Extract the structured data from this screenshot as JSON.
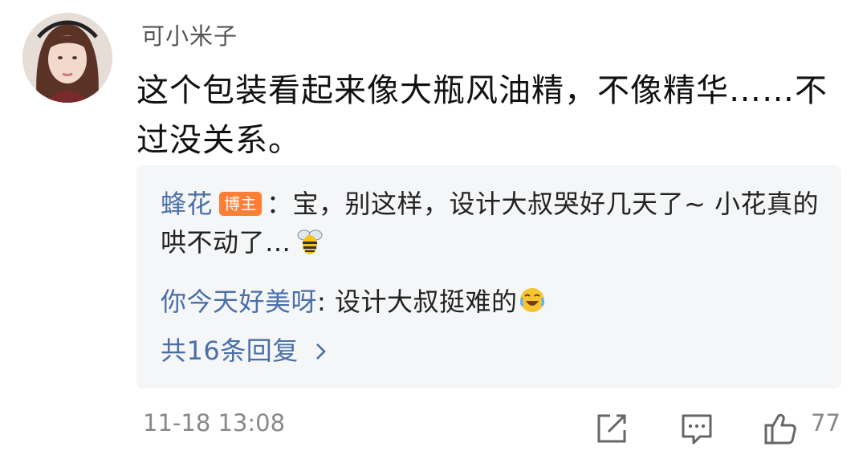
{
  "comment": {
    "username": "可小米子",
    "text": "这个包装看起来像大瓶风油精，不像精华……不过没关系。"
  },
  "replies": [
    {
      "user": "蜂花",
      "badge": "博主",
      "text": "：宝，别这样，设计大叔哭好几天了~ 小花真的哄不动了…",
      "emoji": "bee-emoji"
    },
    {
      "user": "你今天好美呀",
      "text": ": 设计大叔挺难的",
      "emoji": "laugh-cry-emoji"
    }
  ],
  "more_replies": "共16条回复",
  "footer": {
    "timestamp": "11-18 13:08",
    "like_count": "77",
    "icons": [
      "share-icon",
      "comment-icon",
      "like-icon"
    ]
  },
  "colors": {
    "link": "#4a6fa8",
    "badge": "#ff7e36",
    "reply_bg": "#f5f6f7"
  }
}
